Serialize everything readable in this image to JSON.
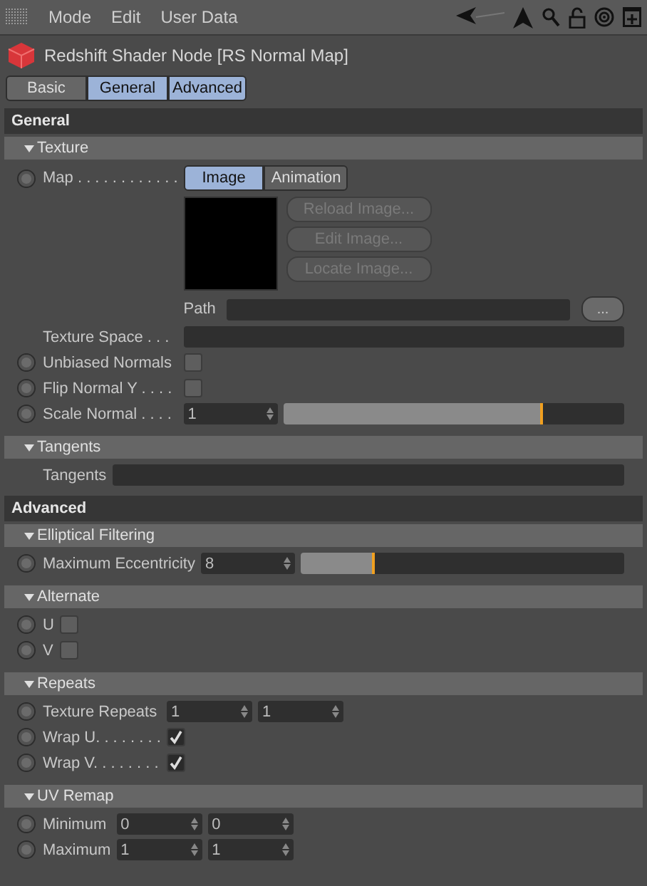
{
  "menu": {
    "items": [
      "Mode",
      "Edit",
      "User Data"
    ]
  },
  "title": "Redshift Shader Node [RS Normal Map]",
  "tabs": [
    {
      "label": "Basic",
      "selected": false
    },
    {
      "label": "General",
      "selected": true
    },
    {
      "label": "Advanced",
      "selected": true
    }
  ],
  "sections": [
    {
      "title": "General",
      "groups": [
        {
          "title": "Texture",
          "expanded": true,
          "rows": [
            {
              "kind": "map",
              "label": "Map . . . . . . . . . . . .",
              "keyframe": true,
              "modes": [
                {
                  "label": "Image",
                  "selected": true
                },
                {
                  "label": "Animation",
                  "selected": false
                }
              ],
              "buttons": [
                {
                  "label": "Reload Image...",
                  "disabled": true
                },
                {
                  "label": "Edit Image...",
                  "disabled": true
                },
                {
                  "label": "Locate Image...",
                  "disabled": true
                }
              ],
              "path_label": "Path",
              "browse": "..."
            },
            {
              "kind": "field",
              "label": "Texture Space . . .",
              "keyframe": false
            },
            {
              "kind": "checkbox",
              "label": "Unbiased Normals",
              "keyframe": true,
              "checked": false
            },
            {
              "kind": "checkbox",
              "label": "Flip Normal Y . . . .",
              "keyframe": true,
              "checked": false
            },
            {
              "kind": "slider",
              "label": "Scale Normal . . . .",
              "keyframe": true,
              "value": "1",
              "level": 0.76
            }
          ]
        },
        {
          "title": "Tangents",
          "expanded": true,
          "rows": [
            {
              "kind": "field",
              "label": "Tangents",
              "keyframe": false
            }
          ]
        }
      ]
    },
    {
      "title": "Advanced",
      "groups": [
        {
          "title": "Elliptical Filtering",
          "expanded": true,
          "rows": [
            {
              "kind": "slider",
              "label": "Maximum Eccentricity",
              "keyframe": true,
              "value": "8",
              "level": 0.23
            }
          ]
        },
        {
          "title": "Alternate",
          "expanded": true,
          "rows": [
            {
              "kind": "checkbox",
              "label": "U",
              "keyframe": true,
              "checked": false
            },
            {
              "kind": "checkbox",
              "label": "V",
              "keyframe": true,
              "checked": false
            }
          ]
        },
        {
          "title": "Repeats",
          "expanded": true,
          "rows": [
            {
              "kind": "pair",
              "label": "Texture Repeats",
              "keyframe": true,
              "values": [
                "1",
                "1"
              ]
            },
            {
              "kind": "checkbox",
              "label": "Wrap U. . . . . . . .",
              "keyframe": true,
              "checked": true
            },
            {
              "kind": "checkbox",
              "label": "Wrap V. . . . . . . .",
              "keyframe": true,
              "checked": true
            }
          ]
        },
        {
          "title": "UV Remap",
          "expanded": true,
          "rows": [
            {
              "kind": "pair",
              "label": "Minimum",
              "keyframe": true,
              "values": [
                "0",
                "0"
              ]
            },
            {
              "kind": "pair",
              "label": "Maximum",
              "keyframe": true,
              "values": [
                "1",
                "1"
              ]
            }
          ]
        }
      ]
    }
  ]
}
